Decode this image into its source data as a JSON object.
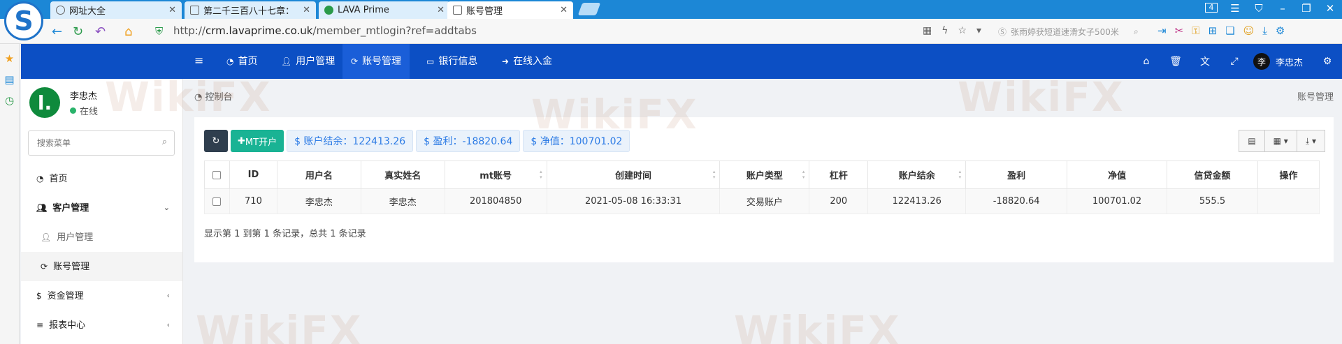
{
  "browser": {
    "tabs": [
      {
        "title": "网址大全",
        "icon": "globe-icon"
      },
      {
        "title": "第二千三百八十七章：",
        "icon": "document-icon"
      },
      {
        "title": "LAVA Prime",
        "icon": "lava-icon"
      },
      {
        "title": "账号管理",
        "icon": "document-icon"
      }
    ],
    "url_prefix": "http://",
    "url_host": "crm.lavaprime.co.uk",
    "url_path": "/member_mtlogin?ref=addtabs",
    "search_text": "张雨婷获短道速滑女子500米",
    "tab_count": "4"
  },
  "topnav": {
    "items": [
      {
        "label": "首页",
        "icon": "dashboard-icon"
      },
      {
        "label": "用户管理",
        "icon": "user-icon"
      },
      {
        "label": "账号管理",
        "icon": "cycle-icon"
      },
      {
        "label": "银行信息",
        "icon": "card-icon"
      },
      {
        "label": "在线入金",
        "icon": "signin-icon"
      }
    ],
    "user_name": "李忠杰",
    "avatar_text": "李"
  },
  "sidebar": {
    "profile_name": "李忠杰",
    "status": "在线",
    "logo_text": "l.",
    "search_placeholder": "搜索菜单",
    "items": [
      {
        "label": "首页"
      },
      {
        "label": "客户管理"
      },
      {
        "label": "用户管理"
      },
      {
        "label": "账号管理"
      },
      {
        "label": "资金管理"
      },
      {
        "label": "报表中心"
      }
    ]
  },
  "main": {
    "breadcrumb": "控制台",
    "page_title": "账号管理",
    "toolbar": {
      "add_label": "MT开户",
      "balance_label": "$ 账户结余：122413.26",
      "profit_label": "$ 盈利：-18820.64",
      "equity_label": "$ 净值：100701.02"
    },
    "table": {
      "headers": [
        "ID",
        "用户名",
        "真实姓名",
        "mt账号",
        "创建时间",
        "账户类型",
        "杠杆",
        "账户结余",
        "盈利",
        "净值",
        "信贷金额",
        "操作"
      ],
      "rows": [
        [
          "710",
          "李忠杰",
          "李忠杰",
          "201804850",
          "2021-05-08 16:33:31",
          "交易账户",
          "200",
          "122413.26",
          "-18820.64",
          "100701.02",
          "555.5",
          ""
        ]
      ]
    },
    "footer": "显示第 1 到第 1 条记录，总共 1 条记录"
  },
  "watermark": "WikiFX",
  "colors": {
    "nav_blue": "#0c4fc4",
    "accent_green": "#19b394",
    "button_dark": "#2f3e4e"
  }
}
